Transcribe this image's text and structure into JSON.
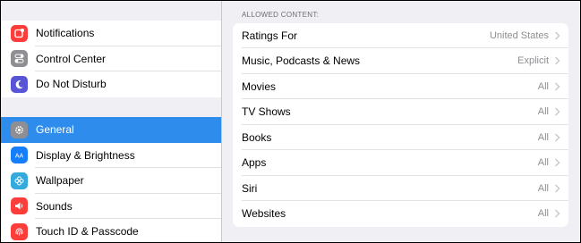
{
  "sidebar": {
    "group1": [
      {
        "label": "Notifications",
        "icon": "notifications-icon",
        "color": "#fc3d39"
      },
      {
        "label": "Control Center",
        "icon": "control-center-icon",
        "color": "#8e8e93"
      },
      {
        "label": "Do Not Disturb",
        "icon": "moon-icon",
        "color": "#5856d6"
      }
    ],
    "group2": [
      {
        "label": "General",
        "icon": "gear-icon",
        "color": "#8e8e93",
        "selected": true
      },
      {
        "label": "Display & Brightness",
        "icon": "display-icon",
        "color": "#147efb"
      },
      {
        "label": "Wallpaper",
        "icon": "wallpaper-icon",
        "color": "#34aadc"
      },
      {
        "label": "Sounds",
        "icon": "speaker-icon",
        "color": "#fc3d39"
      },
      {
        "label": "Touch ID & Passcode",
        "icon": "fingerprint-icon",
        "color": "#fc3d39"
      }
    ]
  },
  "main": {
    "section_header": "ALLOWED CONTENT:",
    "rows": [
      {
        "label": "Ratings For",
        "value": "United States"
      },
      {
        "label": "Music, Podcasts & News",
        "value": "Explicit"
      },
      {
        "label": "Movies",
        "value": "All"
      },
      {
        "label": "TV Shows",
        "value": "All"
      },
      {
        "label": "Books",
        "value": "All"
      },
      {
        "label": "Apps",
        "value": "All"
      },
      {
        "label": "Siri",
        "value": "All"
      },
      {
        "label": "Websites",
        "value": "All"
      }
    ]
  },
  "colors": {
    "selection": "#2e8dec",
    "background": "#efeff4",
    "secondary_text": "#8e8e93"
  }
}
